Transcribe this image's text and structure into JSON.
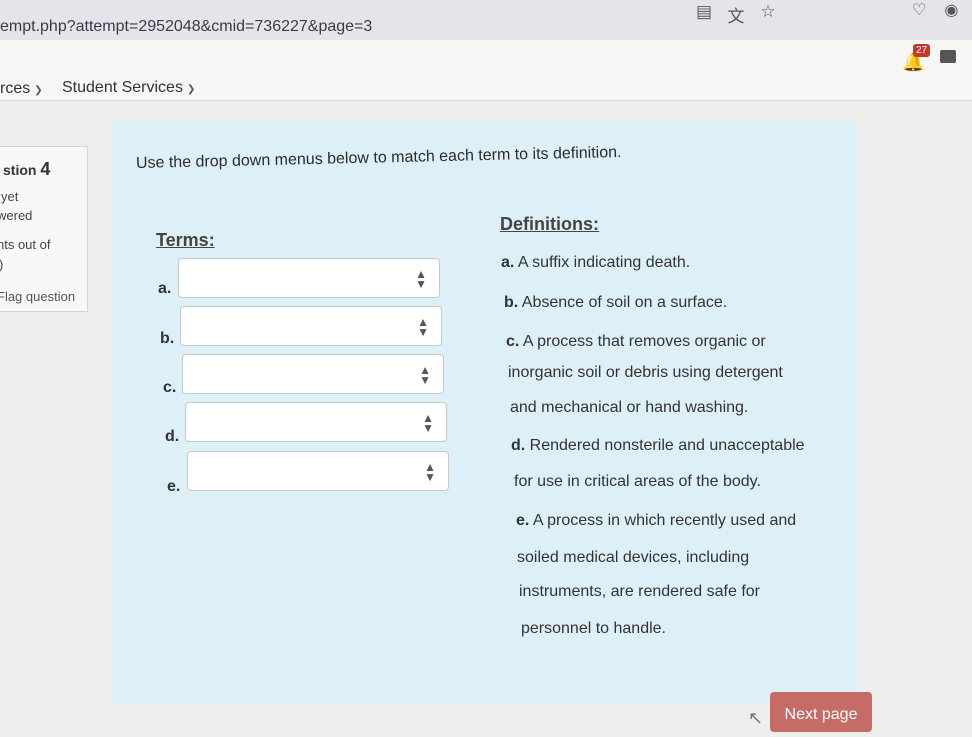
{
  "browser": {
    "url": "empt.php?attempt=2952048&cmid=736227&page=3"
  },
  "nav": {
    "resources_label": "rces",
    "student_services_label": "Student Services",
    "notification_count": "27"
  },
  "question_info": {
    "question_label": "stion",
    "question_number": "4",
    "status_line1": "yet",
    "status_line2": "wered",
    "points_line": "nts out of",
    "points_value": ")",
    "flag_label": "Flag question"
  },
  "question": {
    "instruction": "Use the drop down menus below to match each term to its definition.",
    "terms_header": "Terms:",
    "definitions_header": "Definitions:",
    "terms": [
      {
        "letter": "a.",
        "selected": ""
      },
      {
        "letter": "b.",
        "selected": ""
      },
      {
        "letter": "c.",
        "selected": ""
      },
      {
        "letter": "d.",
        "selected": ""
      },
      {
        "letter": "e.",
        "selected": ""
      }
    ],
    "definitions": {
      "a_letter": "a.",
      "a_text": "A suffix indicating death.",
      "b_letter": "b.",
      "b_text": "Absence of soil on a surface.",
      "c_letter": "c.",
      "c_line1": "A process that removes organic or",
      "c_line2": "inorganic soil or debris using detergent",
      "c_line3": "and mechanical or hand washing.",
      "d_letter": "d.",
      "d_line1": "Rendered nonsterile and unacceptable",
      "d_line2": "for use in critical areas of the body.",
      "e_letter": "e.",
      "e_line1": "A process in which recently used and",
      "e_line2": "soiled medical devices, including",
      "e_line3": "instruments, are rendered safe for",
      "e_line4": "personnel to handle."
    }
  },
  "footer": {
    "next_label": "Next page"
  }
}
